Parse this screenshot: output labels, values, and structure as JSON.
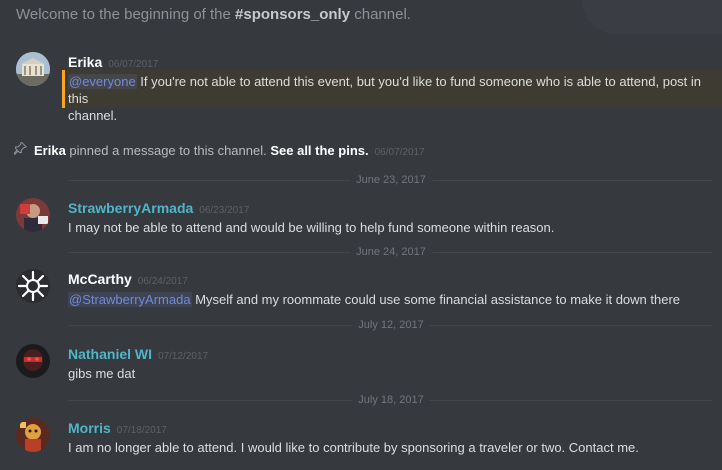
{
  "welcome": {
    "prefix": "Welcome to the beginning of the ",
    "channel": "#sponsors_only",
    "suffix": " channel."
  },
  "messages": [
    {
      "author": "Erika",
      "author_color": "#ffffff",
      "timestamp": "06/07/2017",
      "mention": "@everyone",
      "text": " If you're not able to attend this event, but you'd like to fund someone who is able to attend, post in this",
      "text2": "channel."
    },
    {
      "author": "StrawberryArmada",
      "author_color": "#4fb6c9",
      "timestamp": "06/23/2017",
      "text": "I may not be able to attend and would be willing to help fund someone within reason."
    },
    {
      "author": "McCarthy",
      "author_color": "#ffffff",
      "timestamp": "06/24/2017",
      "mention": "@StrawberryArmada",
      "text": " Myself and my roommate could use some financial assistance to make it down there"
    },
    {
      "author": "Nathaniel WI",
      "author_color": "#4fb6c9",
      "timestamp": "07/12/2017",
      "text": "gibs me dat"
    },
    {
      "author": "Morris",
      "author_color": "#4fb6c9",
      "timestamp": "07/18/2017",
      "text": "I am no longer able to attend. I would like to contribute by sponsoring a traveler or two. Contact me."
    }
  ],
  "pin": {
    "author": "Erika",
    "text": " pinned a message to this channel. ",
    "link": "See all the pins.",
    "timestamp": "06/07/2017"
  },
  "dividers": [
    "June 23, 2017",
    "June 24, 2017",
    "July 12, 2017",
    "July 18, 2017"
  ]
}
